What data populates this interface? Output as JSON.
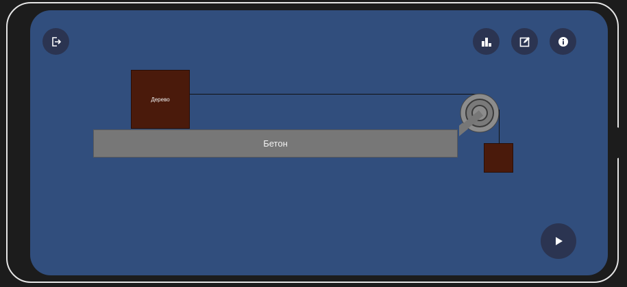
{
  "toolbar": {
    "exit_icon": "exit-icon",
    "chart_icon": "bar-chart-icon",
    "edit_icon": "edit-icon",
    "info_icon": "info-icon",
    "play_icon": "play-icon"
  },
  "scene": {
    "surface_label": "Бетон",
    "block_label": "Дерево"
  },
  "colors": {
    "screen_bg": "#314e7d",
    "button_bg": "#2b3451",
    "surface": "#777777",
    "block": "#4a1a0b",
    "pulley": "#8c8c8c"
  }
}
